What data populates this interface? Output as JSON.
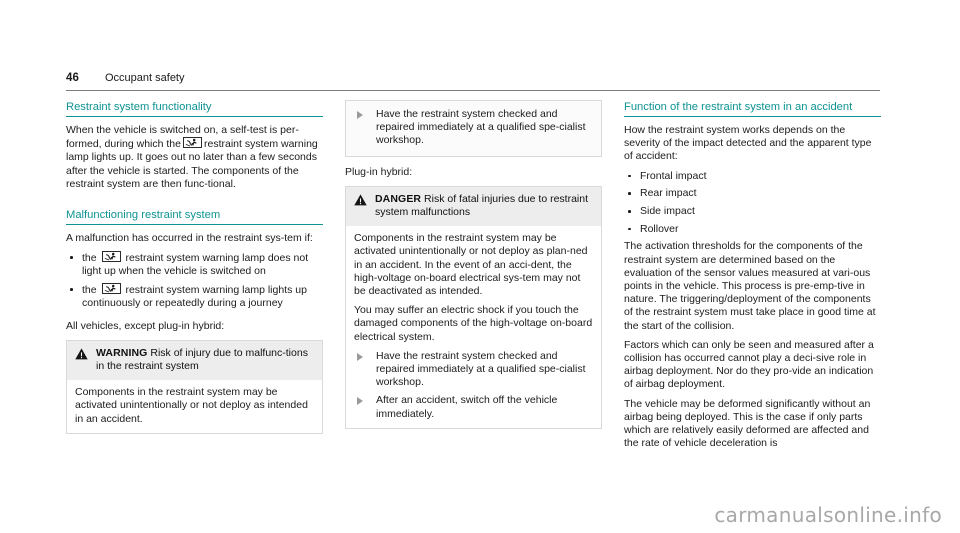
{
  "header": {
    "page_number": "46",
    "title": "Occupant safety"
  },
  "icons": {
    "srs_lamp": "restraint-system-warning-lamp-icon",
    "warning_triangle": "warning-triangle-icon",
    "action_arrow": "action-arrow-icon"
  },
  "colors": {
    "heading_teal": "#0f9393",
    "notice_header_bg": "#ededed",
    "rule_gray": "#7d7d7d",
    "watermark_gray": "#a8a8a8"
  },
  "columns": {
    "left": {
      "heading_1": "Restraint system functionality",
      "para_1_a": "When the vehicle is switched on, a self-test is per-formed, during which the",
      "para_1_b": "restraint system warning lamp lights up. It goes out no later than a few seconds after the vehicle is started. The components of the restraint system are then func-tional.",
      "heading_2": "Malfunctioning restraint system",
      "para_2": "A malfunction has occurred in the restraint sys-tem if:",
      "bullets": [
        {
          "pre": "the",
          "post": "restraint system warning lamp does not light up when the vehicle is switched on"
        },
        {
          "pre": "the",
          "post": "restraint system warning lamp lights up continuously or repeatedly during a journey"
        }
      ],
      "lead_label": "All vehicles, except plug-in hybrid:",
      "warning": {
        "keyword": "WARNING",
        "headline": "Risk of injury due to malfunc-tions in the restraint system",
        "body": [
          "Components in the restraint system may be activated unintentionally or not deploy as intended in an accident."
        ]
      }
    },
    "middle": {
      "warning_continued_actions": [
        "Have the restraint system checked and repaired immediately at a qualified spe-cialist workshop."
      ],
      "lead_label": "Plug-in hybrid:",
      "danger": {
        "keyword": "DANGER",
        "headline": "Risk of fatal injuries due to restraint system malfunctions",
        "body": [
          "Components in the restraint system may be activated unintentionally or not deploy as plan-ned in an accident. In the event of an acci-dent, the high-voltage on-board electrical sys-tem may not be deactivated as intended.",
          "You may suffer an electric shock if you touch the damaged components of the high-voltage on-board electrical system."
        ],
        "actions": [
          "Have the restraint system checked and repaired immediately at a qualified spe-cialist workshop.",
          "After an accident, switch off the vehicle immediately."
        ]
      }
    },
    "right": {
      "heading": "Function of the restraint system in an accident",
      "intro": "How the restraint system works depends on the severity of the impact detected and the apparent type of accident:",
      "bullets": [
        "Frontal impact",
        "Rear impact",
        "Side impact",
        "Rollover"
      ],
      "para_1": "The activation thresholds for the components of the restraint system are determined based on the evaluation of the sensor values measured at vari-ous points in the vehicle. This process is pre-emp-tive in nature. The triggering/deployment of the components of the restraint system must take place in good time at the start of the collision.",
      "para_2": "Factors which can only be seen and measured after a collision has occurred cannot play a deci-sive role in airbag deployment. Nor do they pro-vide an indication of airbag deployment.",
      "para_3": "The vehicle may be deformed significantly without an airbag being deployed. This is the case if only parts which are relatively easily deformed are affected and the rate of vehicle deceleration is"
    }
  },
  "watermark": "carmanualsonline.info"
}
